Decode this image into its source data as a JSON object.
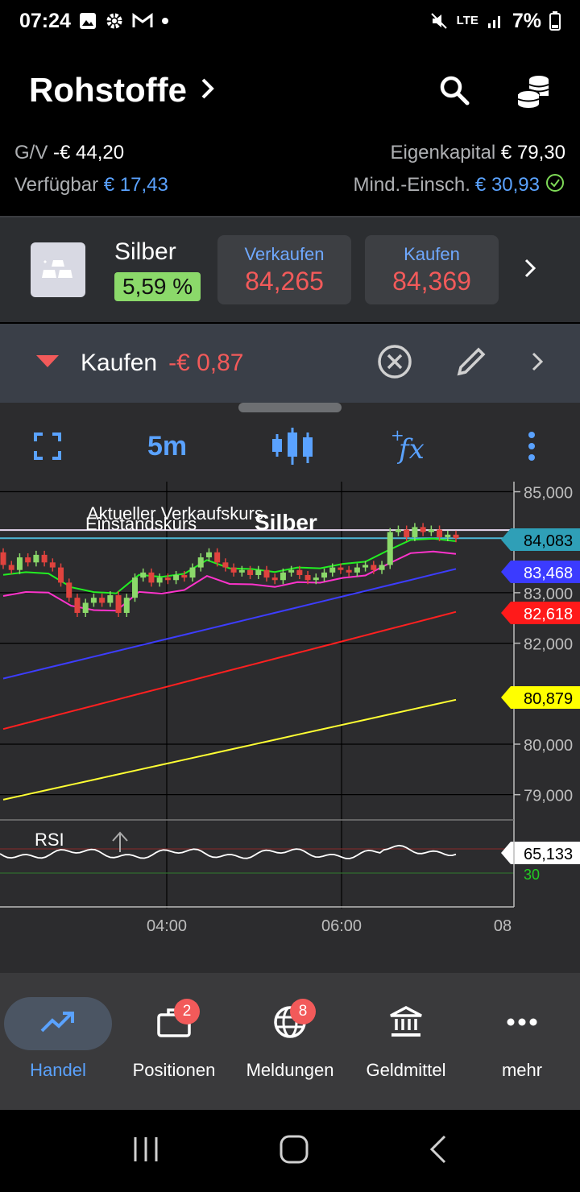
{
  "status": {
    "time": "07:24",
    "network": "LTE",
    "battery": "7%"
  },
  "header": {
    "title": "Rohstoffe",
    "search_icon": "search-icon",
    "coins_icon": "coins-icon"
  },
  "account": {
    "pl_label": "G/V",
    "pl_value": "-€ 44,20",
    "equity_label": "Eigenkapital",
    "equity_value": "€ 79,30",
    "available_label": "Verfügbar",
    "available_value": "€ 17,43",
    "margin_label": "Mind.-Einsch.",
    "margin_value": "€ 30,93"
  },
  "instrument": {
    "name": "Silber",
    "change": "5,59 %",
    "sell_label": "Verkaufen",
    "sell_price": "84,265",
    "buy_label": "Kaufen",
    "buy_price": "84,369"
  },
  "order": {
    "side": "Kaufen",
    "pl": "-€ 0,87"
  },
  "toolbar": {
    "timeframe": "5m"
  },
  "chart_data": {
    "type": "candlestick",
    "title": "Silber",
    "annotations": [
      "Aktueller Verkaufskurs",
      "Einstandskurs"
    ],
    "x_ticks": [
      "04:00",
      "06:00",
      "08"
    ],
    "y_ticks": [
      "85,000",
      "83,000",
      "82,000",
      "80,000",
      "79,000"
    ],
    "ylim": [
      78.5,
      85.2
    ],
    "price_labels": [
      {
        "value": "84,083",
        "color": "#2f9fb7"
      },
      {
        "value": "83,468",
        "color": "#3b3bff"
      },
      {
        "value": "82,618",
        "color": "#ff1a1a"
      },
      {
        "value": "80,879",
        "color": "#ffff00"
      }
    ],
    "candles": [
      [
        83.8,
        83.55
      ],
      [
        83.55,
        83.45
      ],
      [
        83.45,
        83.7
      ],
      [
        83.7,
        83.6
      ],
      [
        83.6,
        83.75
      ],
      [
        83.75,
        83.6
      ],
      [
        83.6,
        83.5
      ],
      [
        83.5,
        83.2
      ],
      [
        83.2,
        82.9
      ],
      [
        82.9,
        82.6
      ],
      [
        82.6,
        82.8
      ],
      [
        82.8,
        82.9
      ],
      [
        82.9,
        82.8
      ],
      [
        82.8,
        82.95
      ],
      [
        82.95,
        82.6
      ],
      [
        82.6,
        82.9
      ],
      [
        82.9,
        83.3
      ],
      [
        83.3,
        83.4
      ],
      [
        83.4,
        83.2
      ],
      [
        83.2,
        83.3
      ],
      [
        83.3,
        83.25
      ],
      [
        83.25,
        83.35
      ],
      [
        83.35,
        83.3
      ],
      [
        83.3,
        83.5
      ],
      [
        83.5,
        83.7
      ],
      [
        83.7,
        83.8
      ],
      [
        83.8,
        83.6
      ],
      [
        83.6,
        83.5
      ],
      [
        83.5,
        83.4
      ],
      [
        83.4,
        83.45
      ],
      [
        83.45,
        83.35
      ],
      [
        83.35,
        83.45
      ],
      [
        83.45,
        83.3
      ],
      [
        83.3,
        83.25
      ],
      [
        83.25,
        83.4
      ],
      [
        83.4,
        83.45
      ],
      [
        83.45,
        83.35
      ],
      [
        83.35,
        83.25
      ],
      [
        83.25,
        83.3
      ],
      [
        83.3,
        83.4
      ],
      [
        83.4,
        83.5
      ],
      [
        83.5,
        83.45
      ],
      [
        83.45,
        83.4
      ],
      [
        83.4,
        83.5
      ],
      [
        83.5,
        83.55
      ],
      [
        83.55,
        83.45
      ],
      [
        83.45,
        83.55
      ],
      [
        83.55,
        84.2
      ],
      [
        84.2,
        84.25
      ],
      [
        84.25,
        84.1
      ],
      [
        84.1,
        84.3
      ],
      [
        84.3,
        84.2
      ],
      [
        84.2,
        84.25
      ],
      [
        84.25,
        84.1
      ],
      [
        84.1,
        84.15
      ],
      [
        84.15,
        84.08
      ]
    ],
    "rsi": {
      "label": "RSI",
      "value": "65,133",
      "levels": [
        70,
        30
      ]
    }
  },
  "bottom_nav": [
    {
      "label": "Handel",
      "icon": "trend-icon",
      "active": true
    },
    {
      "label": "Positionen",
      "icon": "briefcase-icon",
      "badge": "2"
    },
    {
      "label": "Meldungen",
      "icon": "globe-icon",
      "badge": "8"
    },
    {
      "label": "Geldmittel",
      "icon": "bank-icon"
    },
    {
      "label": "mehr",
      "icon": "more-dots-icon"
    }
  ]
}
